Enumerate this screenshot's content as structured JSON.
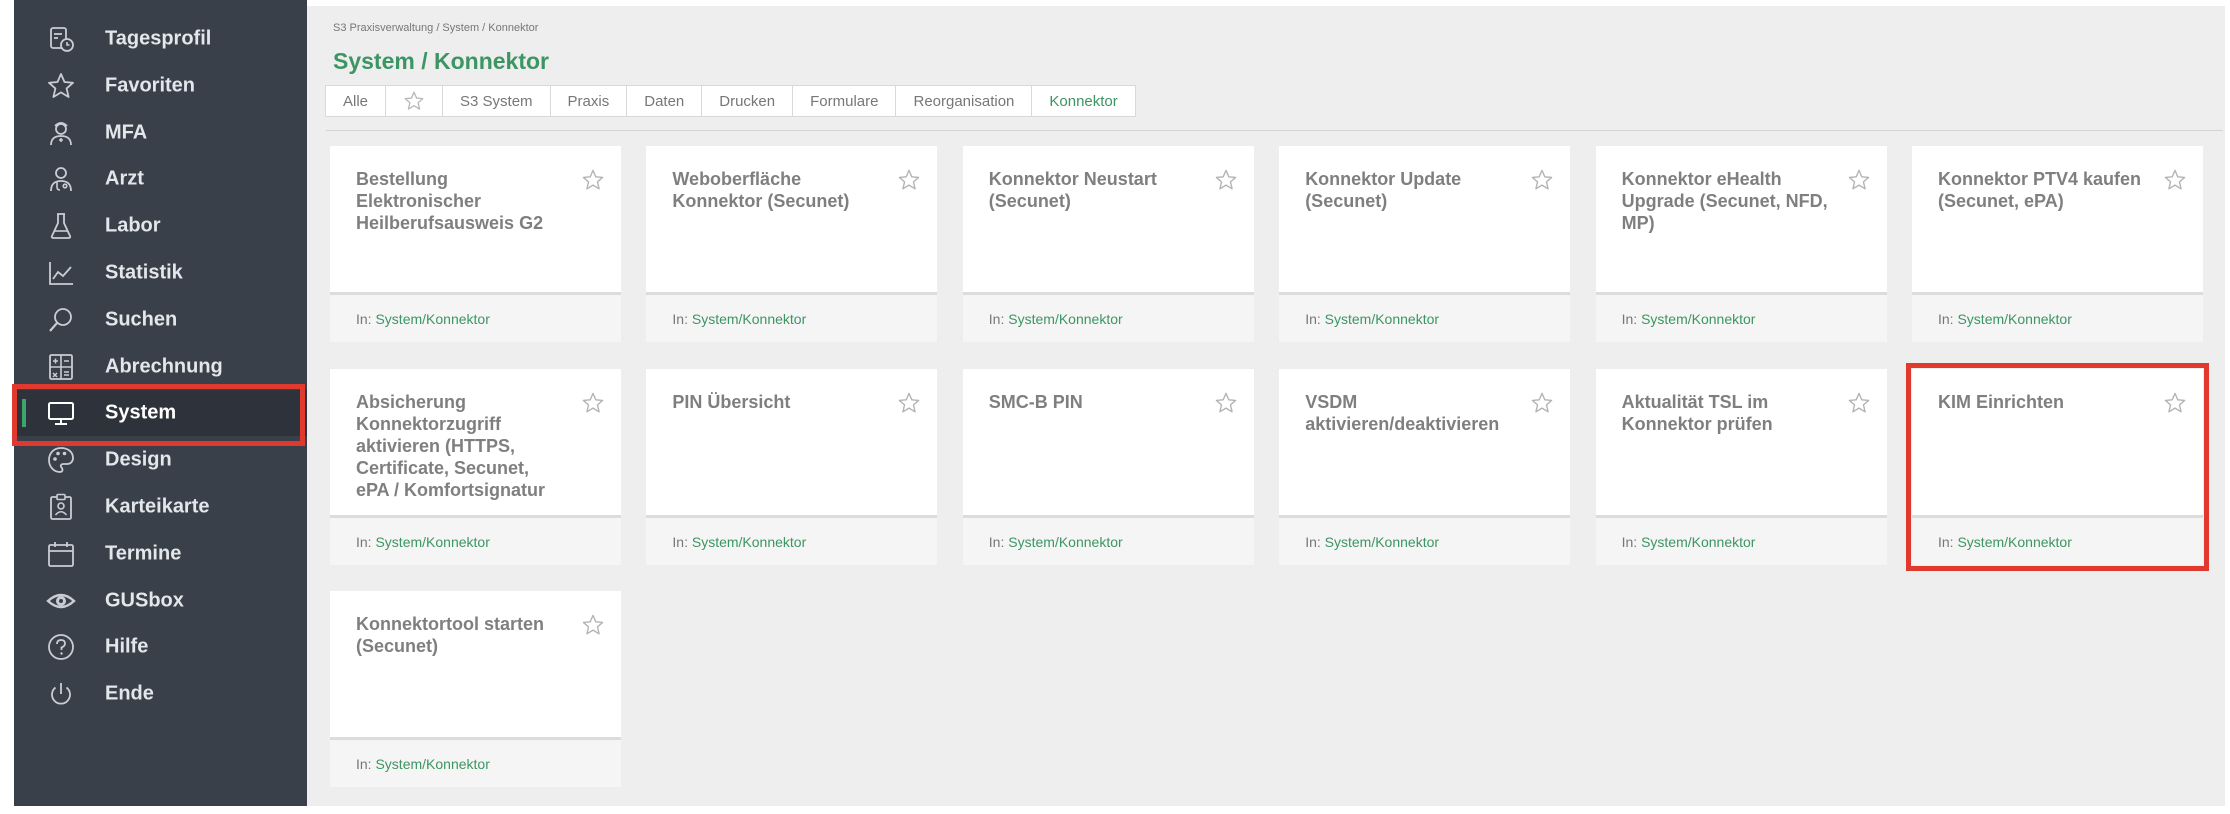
{
  "sidebar": {
    "items": [
      {
        "label": "Tagesprofil",
        "icon": "calendar-clock-icon"
      },
      {
        "label": "Favoriten",
        "icon": "star-icon"
      },
      {
        "label": "MFA",
        "icon": "nurse-icon"
      },
      {
        "label": "Arzt",
        "icon": "doctor-icon"
      },
      {
        "label": "Labor",
        "icon": "flask-icon"
      },
      {
        "label": "Statistik",
        "icon": "chart-line-icon"
      },
      {
        "label": "Suchen",
        "icon": "search-icon"
      },
      {
        "label": "Abrechnung",
        "icon": "calculator-icon"
      },
      {
        "label": "System",
        "icon": "monitor-icon",
        "active": true
      },
      {
        "label": "Design",
        "icon": "palette-icon"
      },
      {
        "label": "Karteikarte",
        "icon": "clipboard-user-icon"
      },
      {
        "label": "Termine",
        "icon": "calendar-icon"
      },
      {
        "label": "GUSbox",
        "icon": "eye-icon"
      },
      {
        "label": "Hilfe",
        "icon": "help-icon"
      },
      {
        "label": "Ende",
        "icon": "power-icon"
      }
    ]
  },
  "main": {
    "breadcrumb": "S3 Praxisverwaltung / System / Konnektor",
    "title": "System / Konnektor",
    "tabs": [
      {
        "label": "Alle"
      },
      {
        "label": "",
        "icon": "star-icon"
      },
      {
        "label": "S3 System"
      },
      {
        "label": "Praxis"
      },
      {
        "label": "Daten"
      },
      {
        "label": "Drucken"
      },
      {
        "label": "Formulare"
      },
      {
        "label": "Reorganisation"
      },
      {
        "label": "Konnektor",
        "active": true
      }
    ],
    "cards": [
      {
        "title": "Bestellung Elektronischer Heilberufsausweis G2",
        "in": "In:",
        "location": "System/Konnektor"
      },
      {
        "title": "Weboberfläche Konnektor (Secunet)",
        "in": "In:",
        "location": "System/Konnektor"
      },
      {
        "title": "Konnektor Neustart (Secunet)",
        "in": "In:",
        "location": "System/Konnektor"
      },
      {
        "title": "Konnektor Update (Secunet)",
        "in": "In:",
        "location": "System/Konnektor"
      },
      {
        "title": "Konnektor eHealth Upgrade (Secunet, NFD, MP)",
        "in": "In:",
        "location": "System/Konnektor"
      },
      {
        "title": "Konnektor PTV4 kaufen (Secunet, ePA)",
        "in": "In:",
        "location": "System/Konnektor"
      },
      {
        "title": "Absicherung Konnektorzugriff aktivieren (HTTPS, Certificate, Secunet, ePA / Komfortsignatur",
        "in": "In:",
        "location": "System/Konnektor"
      },
      {
        "title": "PIN Übersicht",
        "in": "In:",
        "location": "System/Konnektor"
      },
      {
        "title": "SMC-B PIN",
        "in": "In:",
        "location": "System/Konnektor"
      },
      {
        "title": "VSDM aktivieren/deaktivieren",
        "in": "In:",
        "location": "System/Konnektor"
      },
      {
        "title": "Aktualität TSL im Konnektor prüfen",
        "in": "In:",
        "location": "System/Konnektor"
      },
      {
        "title": "KIM Einrichten",
        "in": "In:",
        "location": "System/Konnektor",
        "highlighted": true
      },
      {
        "title": "Konnektortool starten (Secunet)",
        "in": "In:",
        "location": "System/Konnektor"
      }
    ]
  },
  "colors": {
    "sidebar_bg": "#3a4049",
    "accent_green": "#3d9563",
    "highlight_red": "#e03a2f",
    "content_bg": "#eeeeef"
  }
}
